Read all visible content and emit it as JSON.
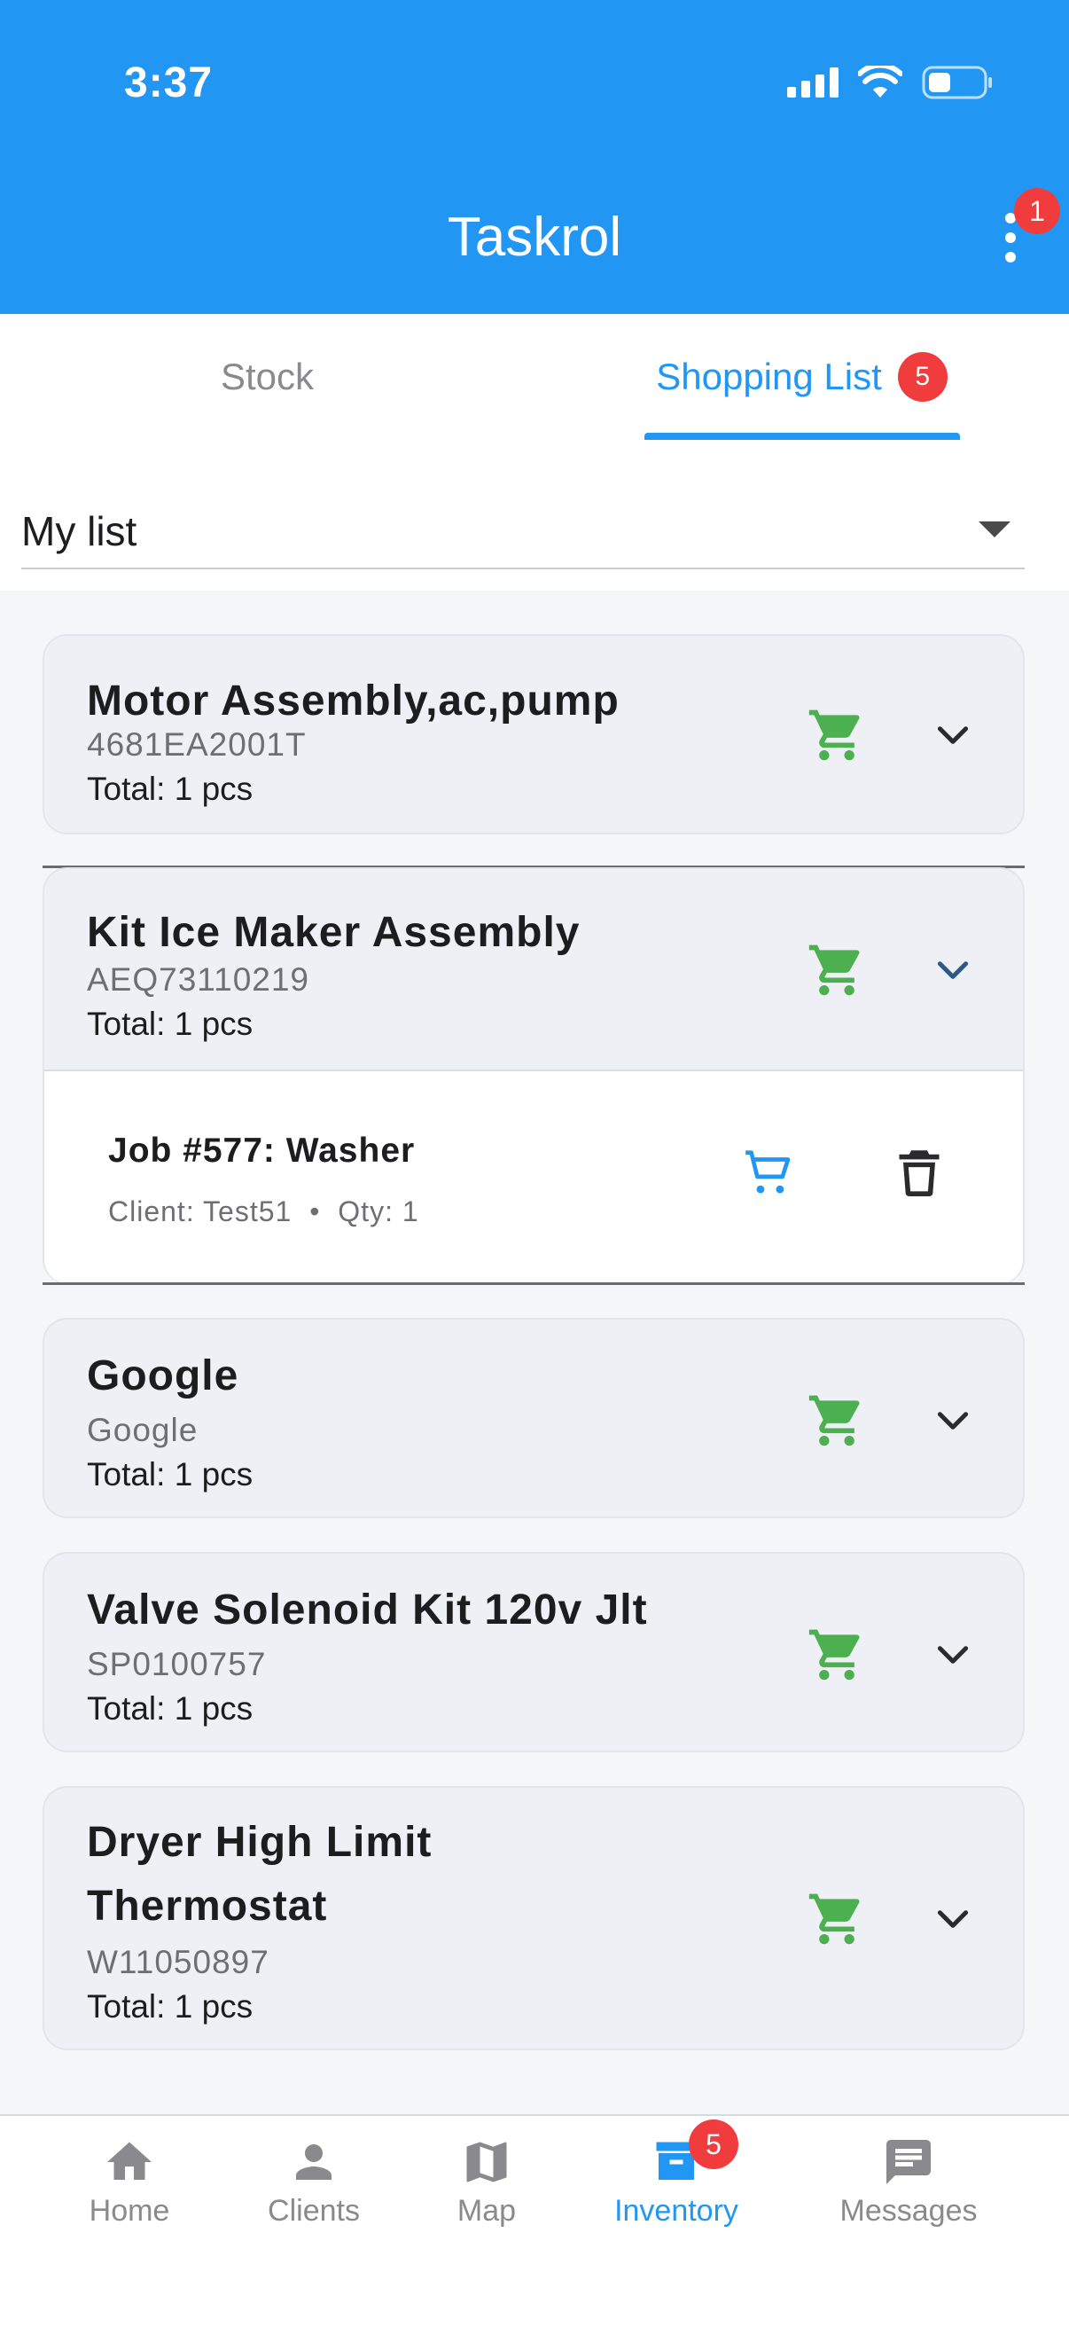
{
  "status_bar": {
    "time": "3:37"
  },
  "app": {
    "title": "Taskrol",
    "menu_badge": "1"
  },
  "tabs": [
    {
      "label": "Stock",
      "active": false
    },
    {
      "label": "Shopping List",
      "active": true,
      "badge": "5"
    }
  ],
  "list_selector": {
    "value": "My list"
  },
  "colors": {
    "primary": "#2196f3",
    "cart_green": "#4caf50",
    "badge_red": "#f03c3c"
  },
  "items": [
    {
      "title": "Motor Assembly,ac,pump",
      "sku": "4681EA2001T",
      "total": "Total: 1 pcs",
      "expanded": false
    },
    {
      "title": "Kit Ice Maker Assembly",
      "sku": "AEQ73110219",
      "total": "Total: 1 pcs",
      "expanded": true,
      "jobs": [
        {
          "title": "Job #577: Washer",
          "client": "Client: Test51",
          "qty": "Qty: 1",
          "separator": "•"
        }
      ]
    },
    {
      "title": "Google",
      "sku": "Google",
      "total": "Total: 1 pcs",
      "expanded": false
    },
    {
      "title": "Valve Solenoid Kit 120v Jlt",
      "sku": "SP0100757",
      "total": "Total: 1 pcs",
      "expanded": false
    },
    {
      "title_line1": "Dryer High Limit",
      "title_line2": "Thermostat",
      "sku": "W11050897",
      "total": "Total: 1 pcs",
      "expanded": false
    }
  ],
  "bottom_nav": [
    {
      "label": "Home",
      "icon": "home-icon"
    },
    {
      "label": "Clients",
      "icon": "person-icon"
    },
    {
      "label": "Map",
      "icon": "map-icon"
    },
    {
      "label": "Inventory",
      "icon": "inventory-icon",
      "active": true,
      "badge": "5"
    },
    {
      "label": "Messages",
      "icon": "message-icon"
    }
  ]
}
